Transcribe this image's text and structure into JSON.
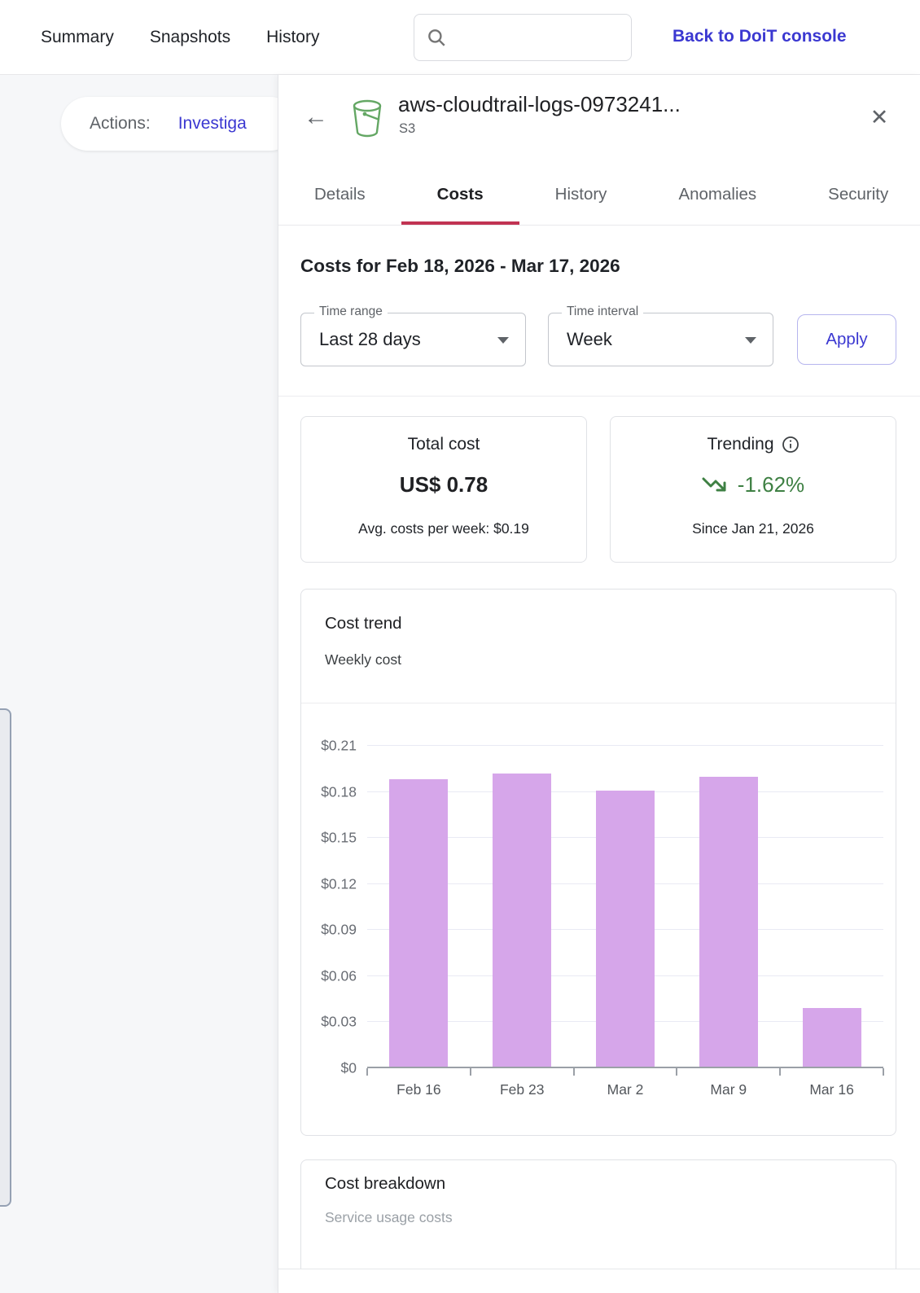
{
  "top_nav": {
    "items": [
      "Summary",
      "Snapshots",
      "History"
    ],
    "search_placeholder": "",
    "back_link": "Back to DoiT console"
  },
  "left_panel": {
    "actions_label": "Actions:",
    "action_link": "Investiga"
  },
  "drawer": {
    "title": "aws-cloudtrail-logs-0973241...",
    "subtitle": "S3",
    "icon": "s3-bucket-icon",
    "tabs": [
      {
        "label": "Details",
        "active": false
      },
      {
        "label": "Costs",
        "active": true
      },
      {
        "label": "History",
        "active": false
      },
      {
        "label": "Anomalies",
        "active": false
      },
      {
        "label": "Security",
        "active": false
      }
    ],
    "costs_heading": "Costs for Feb 18, 2026 - Mar 17, 2026",
    "filters": {
      "time_range_label": "Time range",
      "time_range_value": "Last 28 days",
      "time_interval_label": "Time interval",
      "time_interval_value": "Week",
      "apply_label": "Apply"
    },
    "summary_cards": {
      "total": {
        "title": "Total cost",
        "value": "US$ 0.78",
        "footer": "Avg. costs per week:  $0.19"
      },
      "trending": {
        "title": "Trending",
        "value": "-1.62%",
        "direction": "down",
        "footer": "Since Jan 21, 2026"
      }
    },
    "cost_breakdown": {
      "title": "Cost breakdown",
      "subtitle": "Service usage costs"
    }
  },
  "chart_data": {
    "type": "bar",
    "title": "Cost trend",
    "subtitle": "Weekly cost",
    "categories": [
      "Feb 16",
      "Feb 23",
      "Mar 2",
      "Mar 9",
      "Mar 16"
    ],
    "values": [
      0.187,
      0.191,
      0.18,
      0.189,
      0.038
    ],
    "xlabel": "",
    "ylabel": "",
    "ylim": [
      0,
      0.21
    ],
    "yticks": [
      {
        "v": 0,
        "label": "$0"
      },
      {
        "v": 0.03,
        "label": "$0.03"
      },
      {
        "v": 0.06,
        "label": "$0.06"
      },
      {
        "v": 0.09,
        "label": "$0.09"
      },
      {
        "v": 0.12,
        "label": "$0.12"
      },
      {
        "v": 0.15,
        "label": "$0.15"
      },
      {
        "v": 0.18,
        "label": "$0.18"
      },
      {
        "v": 0.21,
        "label": "$0.21"
      }
    ],
    "grid": "horizontal",
    "legend": "none",
    "bar_color": "#d6a6ea"
  },
  "colors": {
    "accent_link": "#3b38d1",
    "tab_active_underline": "#c13352",
    "trending_green": "#3e8043",
    "bar_purple": "#d6a6ea",
    "bucket_icon_green": "#64a764"
  }
}
